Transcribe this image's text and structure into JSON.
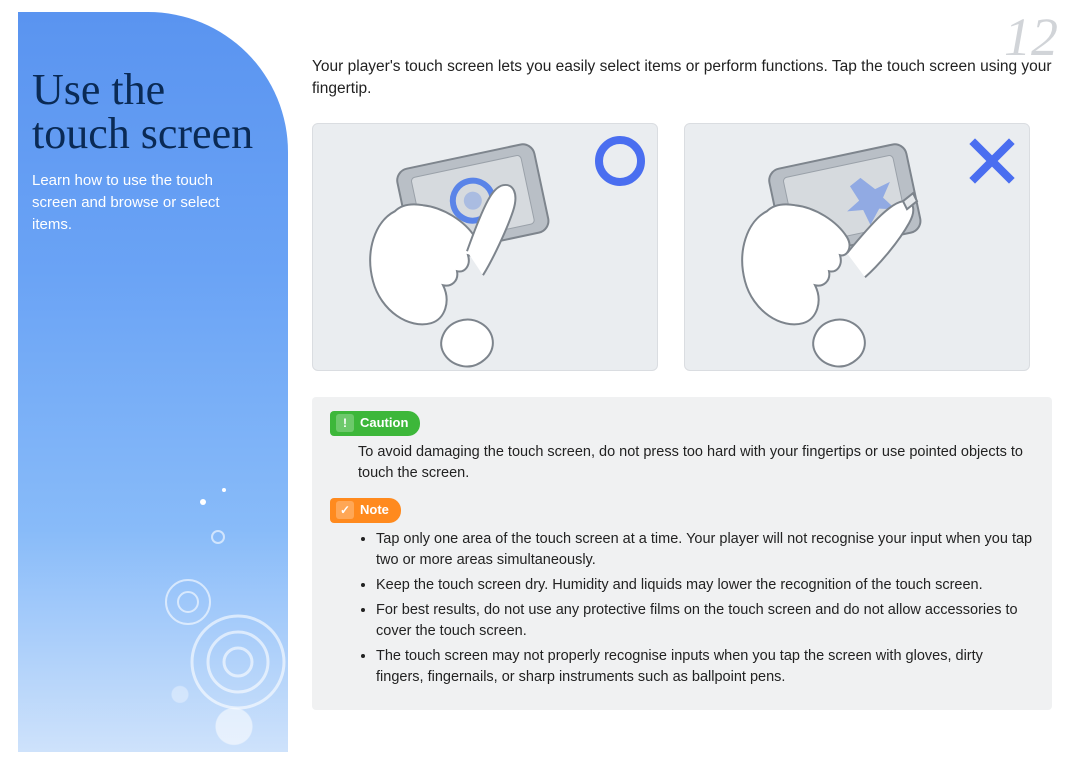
{
  "page_number": "12",
  "sidebar": {
    "title_line1": "Use the",
    "title_line2": "touch screen",
    "subtitle": "Learn how to use the touch screen and browse or select items."
  },
  "intro": "Your player's touch screen lets you easily select items or perform functions. Tap the touch screen using your fingertip.",
  "figures": {
    "correct_alt": "Hand tapping device screen with fingertip (correct)",
    "incorrect_alt": "Hand tapping device screen with fingernail (incorrect)"
  },
  "caution": {
    "label": "Caution",
    "text": "To avoid damaging the touch screen, do not press too hard with your fingertips or use pointed objects to touch the screen."
  },
  "note": {
    "label": "Note",
    "items": [
      "Tap only one area of the touch screen at a time. Your player will not recognise your input when you tap two or more areas simultaneously.",
      "Keep the touch screen dry. Humidity and liquids may lower the recognition of the touch screen.",
      "For best results, do not use any protective films on the touch screen and do not allow accessories to cover the touch screen.",
      "The touch screen may not properly recognise inputs when you tap the screen with gloves, dirty fingers, fingernails, or sharp instruments such as ballpoint pens."
    ]
  }
}
